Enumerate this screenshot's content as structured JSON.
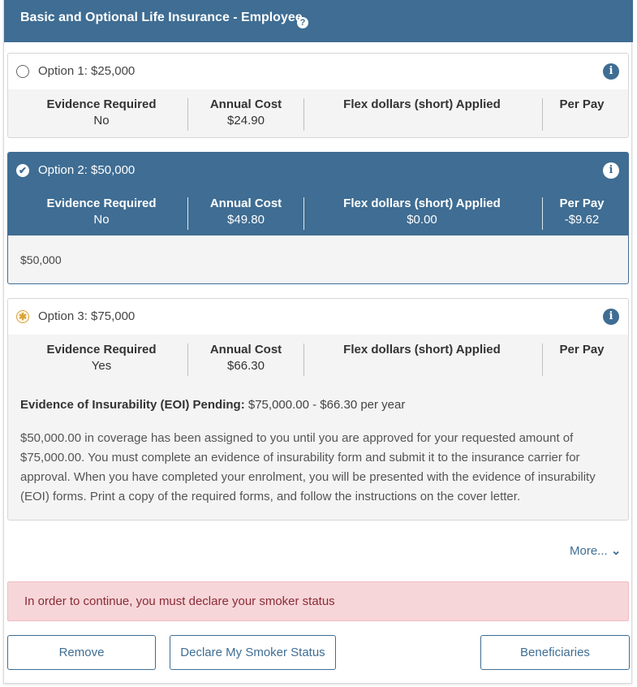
{
  "header": {
    "title": "Basic and Optional Life Insurance - Employee",
    "help_icon": "?"
  },
  "labels": {
    "evidence": "Evidence Required",
    "annual": "Annual Cost",
    "flex": "Flex dollars (short) Applied",
    "perpay": "Per Pay"
  },
  "options": [
    {
      "label": "Option 1: $25,000",
      "state": "unselected",
      "evidence": "No",
      "annual": "$24.90",
      "flex": "",
      "perpay": ""
    },
    {
      "label": "Option 2: $50,000",
      "state": "selected",
      "evidence": "No",
      "annual": "$49.80",
      "flex": "$0.00",
      "perpay": "-$9.62",
      "coverage": "$50,000"
    },
    {
      "label": "Option 3: $75,000",
      "state": "pending",
      "evidence": "Yes",
      "annual": "$66.30",
      "flex": "",
      "perpay": "",
      "eoi_title": "Evidence of Insurability (EOI) Pending:",
      "eoi_amount": "$75,000.00 - $66.30 per year",
      "eoi_text": "$50,000.00 in coverage has been assigned to you until you are approved for your requested amount of $75,000.00. You must complete an evidence of insurability form and submit it to the insurance carrier for approval. When you have completed your enrolment, you will be presented with the evidence of insurability (EOI) forms. Print a copy of the required forms, and follow the instructions on the cover letter."
    }
  ],
  "more": {
    "label": "More...",
    "icon": "chevron-down-icon"
  },
  "alert": {
    "text": "In order to continue, you must declare your smoker status"
  },
  "buttons": {
    "remove": "Remove",
    "declare": "Declare My Smoker Status",
    "beneficiaries": "Beneficiaries"
  },
  "colors": {
    "primary": "#3f6d93",
    "alert_bg": "#f7d6da",
    "alert_text": "#8a2b35",
    "pending": "#d7a23a"
  }
}
